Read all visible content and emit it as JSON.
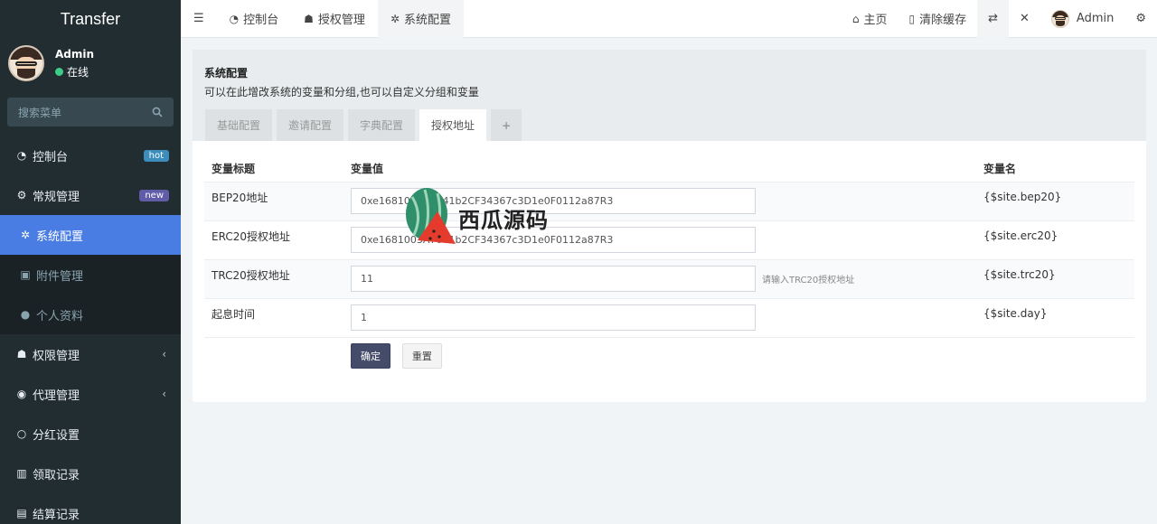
{
  "app": {
    "title": "Transfer"
  },
  "user": {
    "name": "Admin",
    "status": "在线"
  },
  "sidebar": {
    "search_placeholder": "搜索菜单",
    "items": [
      {
        "label": "控制台",
        "icon": "dashboard-icon",
        "badge": "hot"
      },
      {
        "label": "常规管理",
        "icon": "cogs-icon",
        "badge": "new"
      },
      {
        "label": "系统配置",
        "icon": "gear-icon",
        "active": true
      },
      {
        "label": "附件管理",
        "icon": "image-icon"
      },
      {
        "label": "个人资料",
        "icon": "user-icon"
      },
      {
        "label": "权限管理",
        "icon": "users-icon"
      },
      {
        "label": "代理管理",
        "icon": "user-circle-icon"
      },
      {
        "label": "分红设置",
        "icon": "circle-icon"
      },
      {
        "label": "领取记录",
        "icon": "bank-icon"
      },
      {
        "label": "结算记录",
        "icon": "calculator-icon"
      }
    ]
  },
  "topbar": {
    "tabs": [
      {
        "label": "控制台"
      },
      {
        "label": "授权管理"
      },
      {
        "label": "系统配置"
      }
    ],
    "home": "主页",
    "clear_cache": "清除缓存",
    "admin": "Admin"
  },
  "panel": {
    "title": "系统配置",
    "description": "可以在此增改系统的变量和分组,也可以自定义分组和变量",
    "tabs": [
      "基础配置",
      "邀请配置",
      "字典配置",
      "授权地址",
      "+"
    ],
    "table": {
      "headers": [
        "变量标题",
        "变量值",
        "变量名"
      ],
      "rows": [
        {
          "title": "BEP20地址",
          "value": "0xe1681003A7041b2CF34367c3D1e0F0112a87R3",
          "tip": "",
          "varname": "{$site.bep20}"
        },
        {
          "title": "ERC20授权地址",
          "value": "0xe1681003A7041b2CF34367c3D1e0F0112a87R3",
          "tip": "",
          "varname": "{$site.erc20}"
        },
        {
          "title": "TRC20授权地址",
          "value": "11",
          "tip": "请输入TRC20授权地址",
          "varname": "{$site.trc20}"
        },
        {
          "title": "起息时间",
          "value": "1",
          "tip": "",
          "varname": "{$site.day}"
        }
      ]
    },
    "buttons": {
      "submit": "确定",
      "reset": "重置"
    }
  },
  "watermark": {
    "text": "西瓜源码"
  }
}
